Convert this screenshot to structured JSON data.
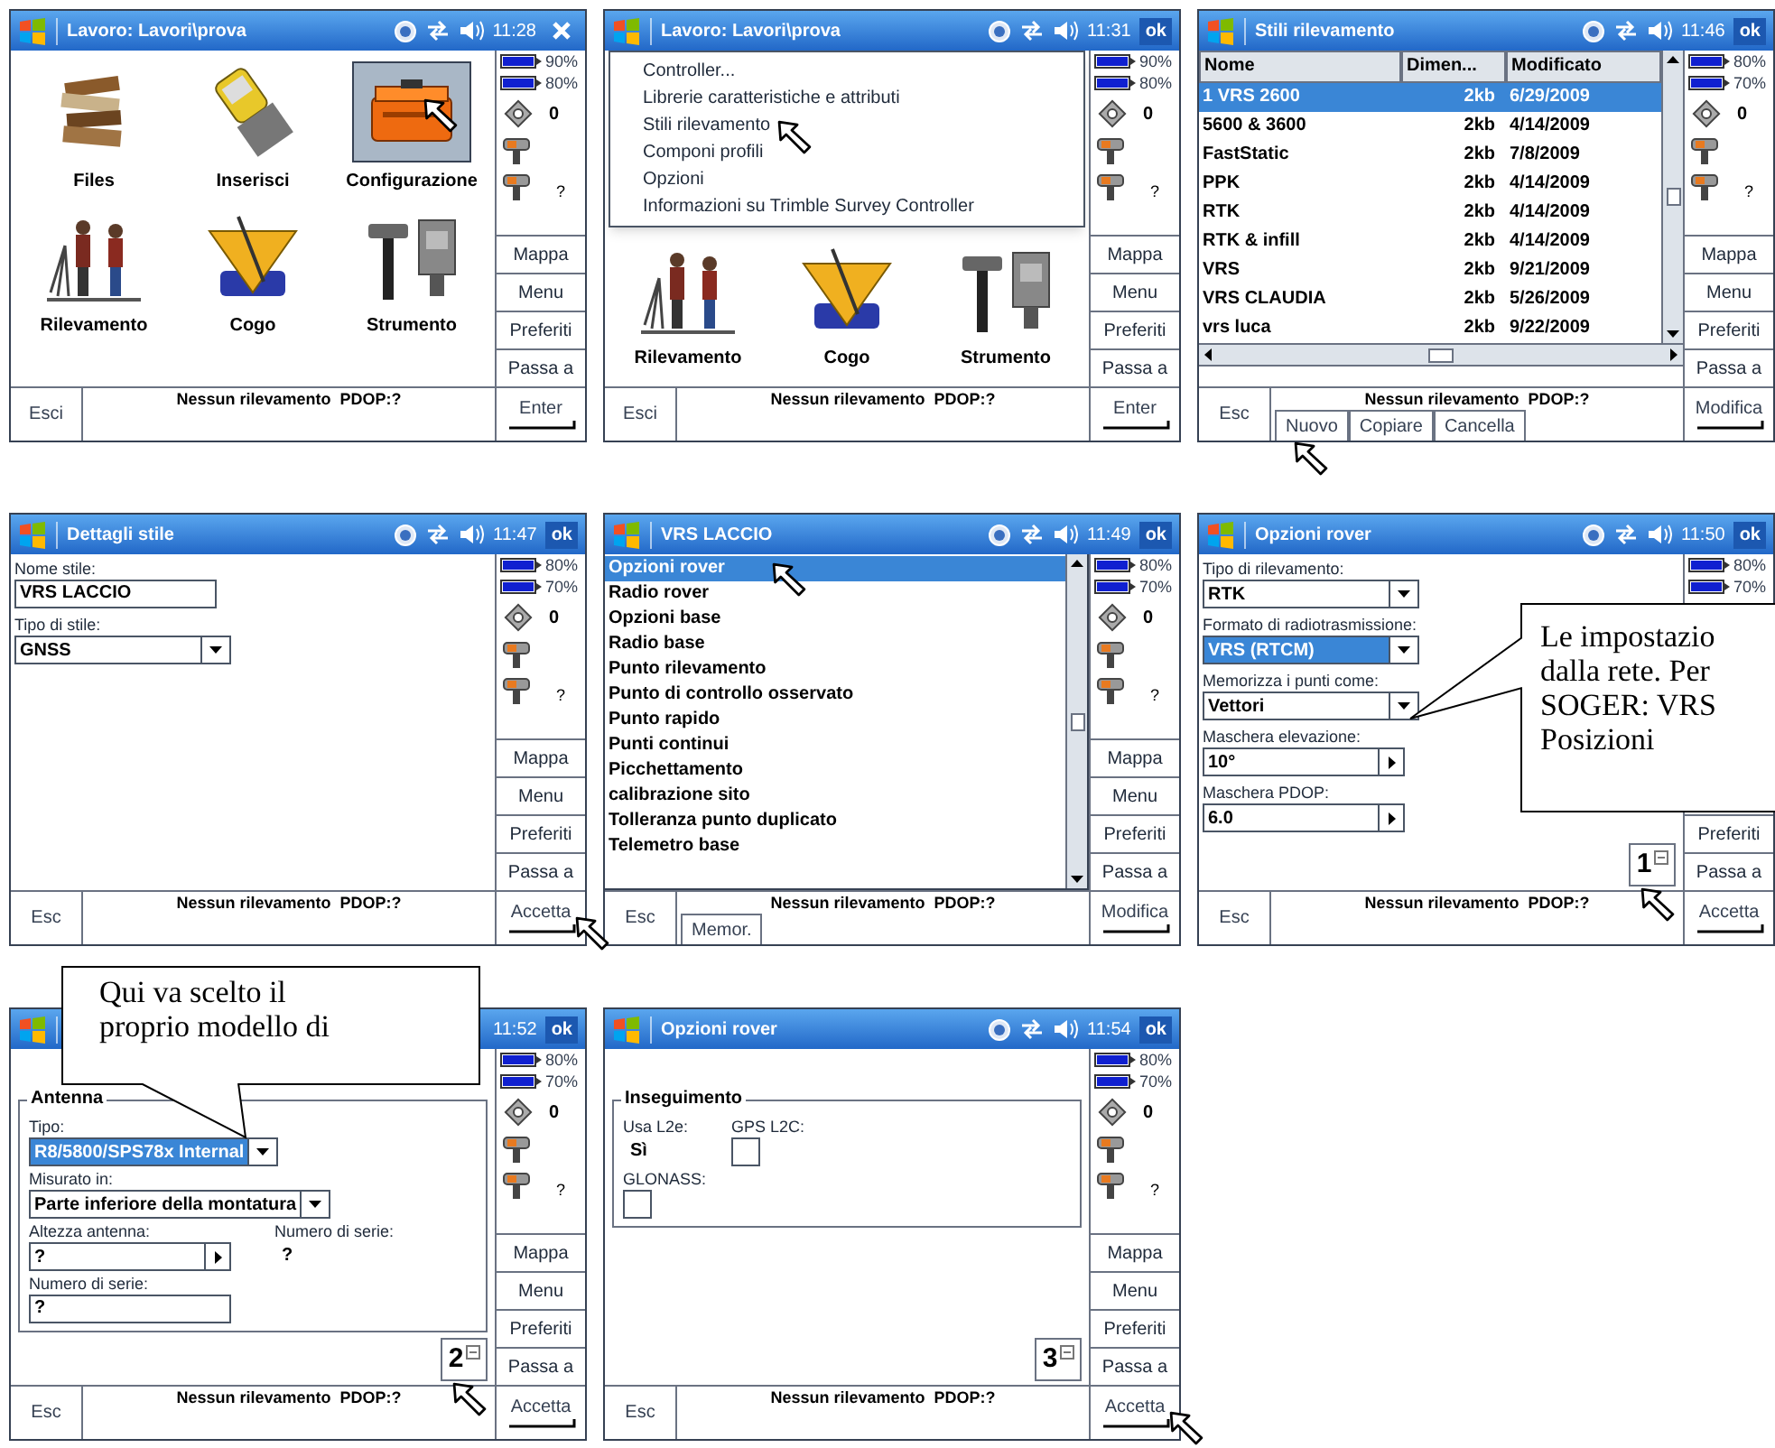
{
  "screens": [
    {
      "title_bar": {
        "title": "Lavoro: Lavori\\prova",
        "status_icons": true,
        "time": "11:28",
        "action": {
          "kind": "close"
        }
      },
      "body": {
        "kind": "grid",
        "items": [
          {
            "kind": "files",
            "label": "Files",
            "selected": false,
            "pointed": false
          },
          {
            "kind": "device",
            "label": "Inserisci",
            "selected": false,
            "pointed": false
          },
          {
            "kind": "toolbox",
            "label": "Configurazione",
            "selected": true,
            "pointed": true
          },
          {
            "kind": "people",
            "label": "Rilevamento",
            "selected": false,
            "pointed": false
          },
          {
            "kind": "cogo",
            "label": "Cogo",
            "selected": false,
            "pointed": false
          },
          {
            "kind": "instrument",
            "label": "Strumento",
            "selected": false,
            "pointed": false
          }
        ]
      },
      "sidebar": {
        "batteries": [
          "90%",
          "80%"
        ],
        "satellites": "0",
        "receiver_status": "?",
        "buttons": [
          "Mappa",
          "Menu",
          "Preferiti",
          "Passa a"
        ]
      },
      "bottom": {
        "left": "Esci",
        "status": "Nessun rilevamento  PDOP:?",
        "right": {
          "label": "Enter",
          "pointed": false
        }
      }
    },
    {
      "title_bar": {
        "title": "Lavoro: Lavori\\prova",
        "status_icons": true,
        "time": "11:31",
        "action": {
          "kind": "ok",
          "label": "ok"
        }
      },
      "body": {
        "kind": "grid",
        "menu": [
          {
            "label": "Controller..."
          },
          {
            "label": "Librerie caratteristiche e attributi"
          },
          {
            "label": "Stili rilevamento",
            "pointed": true
          },
          {
            "label": "Componi profili"
          },
          {
            "label": "Opzioni"
          },
          {
            "label": "Informazioni su Trimble Survey Controller"
          }
        ],
        "items": [
          {
            "kind": "people",
            "label": "Rilevamento",
            "selected": false,
            "pointed": false
          },
          {
            "kind": "cogo",
            "label": "Cogo",
            "selected": false,
            "pointed": false
          },
          {
            "kind": "instrument",
            "label": "Strumento",
            "selected": false,
            "pointed": false
          }
        ]
      },
      "sidebar": {
        "batteries": [
          "90%",
          "80%"
        ],
        "satellites": "0",
        "receiver_status": "?",
        "buttons": [
          "Mappa",
          "Menu",
          "Preferiti",
          "Passa a"
        ]
      },
      "bottom": {
        "left": "Esci",
        "status": "Nessun rilevamento  PDOP:?",
        "right": {
          "label": "Enter",
          "pointed": false
        }
      }
    },
    {
      "title_bar": {
        "title": "Stili rilevamento",
        "status_icons": true,
        "time": "11:46",
        "action": {
          "kind": "ok",
          "label": "ok"
        }
      },
      "body": {
        "kind": "table",
        "columns": [
          "Nome",
          "Dimen...",
          "Modificato"
        ],
        "rows": [
          {
            "cells": [
              "1 VRS 2600",
              "2kb",
              "6/29/2009"
            ],
            "selected": true
          },
          {
            "cells": [
              "5600 & 3600",
              "2kb",
              "4/14/2009"
            ],
            "selected": false
          },
          {
            "cells": [
              "FastStatic",
              "2kb",
              "7/8/2009"
            ],
            "selected": false
          },
          {
            "cells": [
              "PPK",
              "2kb",
              "4/14/2009"
            ],
            "selected": false
          },
          {
            "cells": [
              "RTK",
              "2kb",
              "4/14/2009"
            ],
            "selected": false
          },
          {
            "cells": [
              "RTK & infill",
              "2kb",
              "4/14/2009"
            ],
            "selected": false
          },
          {
            "cells": [
              "VRS",
              "2kb",
              "9/21/2009"
            ],
            "selected": false
          },
          {
            "cells": [
              "VRS CLAUDIA",
              "2kb",
              "5/26/2009"
            ],
            "selected": false
          },
          {
            "cells": [
              "vrs luca",
              "2kb",
              "9/22/2009"
            ],
            "selected": false
          }
        ]
      },
      "sidebar": {
        "batteries": [
          "80%",
          "70%"
        ],
        "satellites": "0",
        "receiver_status": "?",
        "buttons": [
          "Mappa",
          "Menu",
          "Preferiti",
          "Passa a"
        ]
      },
      "bottom": {
        "left": "Esc",
        "status": "Nessun rilevamento  PDOP:?",
        "buttons": [
          {
            "label": "Nuovo",
            "pointed": true
          },
          {
            "label": "Copiare"
          },
          {
            "label": "Cancella"
          }
        ],
        "right": {
          "label": "Modifica",
          "pointed": false
        }
      }
    },
    {
      "title_bar": {
        "title": "Dettagli stile",
        "status_icons": true,
        "time": "11:47",
        "action": {
          "kind": "ok",
          "label": "ok"
        }
      },
      "body": {
        "kind": "form",
        "rows": [
          [
            {
              "kind": "text",
              "label": "Nome stile:",
              "value": "VRS LACCIO"
            }
          ],
          [
            {
              "kind": "dropdown",
              "label": "Tipo di stile:",
              "value": "GNSS",
              "selected": false
            }
          ]
        ]
      },
      "sidebar": {
        "batteries": [
          "80%",
          "70%"
        ],
        "satellites": "0",
        "receiver_status": "?",
        "buttons": [
          "Mappa",
          "Menu",
          "Preferiti",
          "Passa a"
        ]
      },
      "bottom": {
        "left": "Esc",
        "status": "Nessun rilevamento  PDOP:?",
        "right": {
          "label": "Accetta",
          "pointed": true
        }
      }
    },
    {
      "title_bar": {
        "title": "VRS LACCIO",
        "status_icons": true,
        "time": "11:49",
        "action": {
          "kind": "ok",
          "label": "ok"
        }
      },
      "body": {
        "kind": "list",
        "items": [
          {
            "label": "Opzioni rover",
            "selected": true,
            "pointed": true
          },
          {
            "label": "Radio rover",
            "selected": false,
            "pointed": false
          },
          {
            "label": "Opzioni base",
            "selected": false,
            "pointed": false
          },
          {
            "label": "Radio base",
            "selected": false,
            "pointed": false
          },
          {
            "label": "Punto rilevamento",
            "selected": false,
            "pointed": false
          },
          {
            "label": "Punto di controllo osservato",
            "selected": false,
            "pointed": false
          },
          {
            "label": "Punto rapido",
            "selected": false,
            "pointed": false
          },
          {
            "label": "Punti continui",
            "selected": false,
            "pointed": false
          },
          {
            "label": "Picchettamento",
            "selected": false,
            "pointed": false
          },
          {
            "label": "calibrazione sito",
            "selected": false,
            "pointed": false
          },
          {
            "label": "Tolleranza punto duplicato",
            "selected": false,
            "pointed": false
          },
          {
            "label": "Telemetro base",
            "selected": false,
            "pointed": false
          }
        ]
      },
      "sidebar": {
        "batteries": [
          "80%",
          "70%"
        ],
        "satellites": "0",
        "receiver_status": "?",
        "buttons": [
          "Mappa",
          "Menu",
          "Preferiti",
          "Passa a"
        ]
      },
      "bottom": {
        "left": "Esc",
        "status": "Nessun rilevamento  PDOP:?",
        "buttons": [
          {
            "label": "Memor."
          }
        ],
        "right": {
          "label": "Modifica",
          "pointed": false
        }
      }
    },
    {
      "title_bar": {
        "title": "Opzioni rover",
        "status_icons": true,
        "time": "11:50",
        "action": {
          "kind": "ok",
          "label": "ok"
        }
      },
      "body": {
        "kind": "form",
        "rows": [
          [
            {
              "kind": "dropdown",
              "label": "Tipo di rilevamento:",
              "value": "RTK",
              "selected": false
            }
          ],
          [
            {
              "kind": "dropdown",
              "label": "Formato di radiotrasmissione:",
              "value": "VRS (RTCM)",
              "selected": true
            }
          ],
          [
            {
              "kind": "dropdown",
              "label": "Memorizza i punti come:",
              "value": "Vettori",
              "selected": false
            }
          ],
          [
            {
              "kind": "arrow",
              "label": "Maschera elevazione:",
              "value": "10°"
            }
          ],
          [
            {
              "kind": "arrow",
              "label": "Maschera PDOP:",
              "value": "6.0"
            }
          ]
        ],
        "page": {
          "number": "1",
          "pointed": true
        }
      },
      "sidebar": {
        "batteries": [
          "80%",
          "70%"
        ],
        "buttons": [
          "Preferiti",
          "Passa a"
        ]
      },
      "bottom": {
        "left": "Esc",
        "status": "Nessun rilevamento  PDOP:?",
        "right": {
          "label": "Accetta",
          "pointed": false
        }
      },
      "callout": {
        "kind": "right",
        "lines": [
          "Le impostazio",
          "dalla rete. Per",
          "SOGER: VRS",
          "Posizioni"
        ]
      }
    },
    {
      "title_bar": {
        "status_icons": false,
        "time": "11:52",
        "action": {
          "kind": "ok",
          "label": "ok"
        }
      },
      "body": {
        "kind": "form",
        "group": "Antenna",
        "rows": [
          [
            {
              "kind": "dropdown",
              "label": "Tipo:",
              "value": "R8/5800/SPS78x Internal",
              "selected": true
            }
          ],
          [
            {
              "kind": "dropdown",
              "label": "Misurato in:",
              "value": "Parte inferiore della montatura",
              "selected": false
            }
          ],
          [
            {
              "kind": "arrow",
              "label": "Altezza antenna:",
              "value": "?"
            },
            {
              "kind": "value",
              "label": "Numero di serie:",
              "value": "?"
            }
          ],
          [
            {
              "kind": "text",
              "label": "Numero di serie:",
              "value": "?"
            }
          ]
        ],
        "page": {
          "number": "2",
          "pointed": true
        }
      },
      "sidebar": {
        "batteries": [
          "80%",
          "70%"
        ],
        "satellites": "0",
        "receiver_status": "?",
        "buttons": [
          "Mappa",
          "Menu",
          "Preferiti",
          "Passa a"
        ]
      },
      "bottom": {
        "left": "Esc",
        "status": "Nessun rilevamento  PDOP:?",
        "right": {
          "label": "Accetta",
          "pointed": false
        }
      },
      "callout": {
        "kind": "top",
        "lines": [
          "Qui va scelto il",
          "proprio modello di"
        ]
      }
    },
    {
      "title_bar": {
        "title": "Opzioni rover",
        "status_icons": true,
        "time": "11:54",
        "action": {
          "kind": "ok",
          "label": "ok"
        }
      },
      "body": {
        "kind": "form",
        "group": "Inseguimento",
        "rows": [
          [
            {
              "kind": "value",
              "label": "Usa L2e:",
              "value": "Sì"
            },
            {
              "kind": "checkbox",
              "label": "GPS L2C:",
              "checked": false
            }
          ],
          [
            {
              "kind": "checkbox",
              "label": "GLONASS:",
              "checked": false
            }
          ]
        ],
        "page": {
          "number": "3"
        }
      },
      "sidebar": {
        "batteries": [
          "80%",
          "70%"
        ],
        "satellites": "0",
        "receiver_status": "?",
        "buttons": [
          "Mappa",
          "Menu",
          "Preferiti",
          "Passa a"
        ]
      },
      "bottom": {
        "left": "Esc",
        "status": "Nessun rilevamento  PDOP:?",
        "right": {
          "label": "Accetta",
          "pointed": true
        }
      }
    }
  ]
}
